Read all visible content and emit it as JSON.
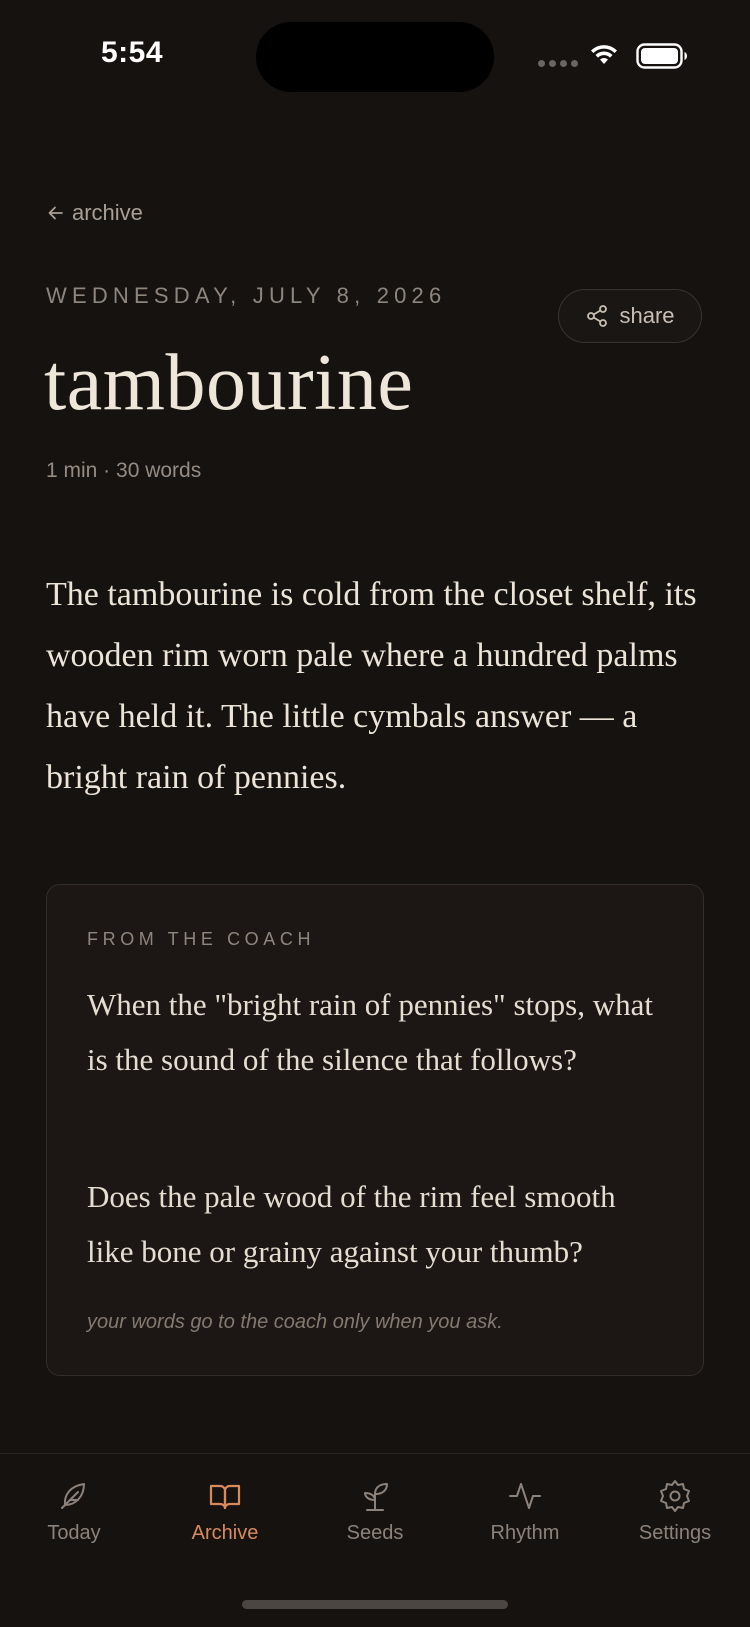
{
  "status_bar": {
    "time": "5:54"
  },
  "header": {
    "back_label": "archive",
    "date": "WEDNESDAY, JULY 8, 2026",
    "share_label": "share",
    "title": "tambourine",
    "meta": "1 min · 30 words"
  },
  "entry": {
    "body": "The tambourine is cold from the closet shelf, its wooden rim worn pale where a hundred palms have held it. The little cymbals answer — a bright rain of pennies."
  },
  "coach": {
    "label": "FROM THE COACH",
    "questions": [
      "When the \"bright rain of pennies\" stops, what is the sound of the silence that follows?",
      "Does the pale wood of the rim feel smooth like bone or grainy against your thumb?"
    ],
    "note": "your words go to the coach only when you ask."
  },
  "tabs": [
    {
      "label": "Today",
      "icon": "feather-icon",
      "active": false
    },
    {
      "label": "Archive",
      "icon": "book-icon",
      "active": true
    },
    {
      "label": "Seeds",
      "icon": "sprout-icon",
      "active": false
    },
    {
      "label": "Rhythm",
      "icon": "pulse-icon",
      "active": false
    },
    {
      "label": "Settings",
      "icon": "gear-icon",
      "active": false
    }
  ],
  "colors": {
    "background": "#161210",
    "accent": "#d98a5c",
    "text": "#efe6da",
    "muted": "#8c827a"
  }
}
